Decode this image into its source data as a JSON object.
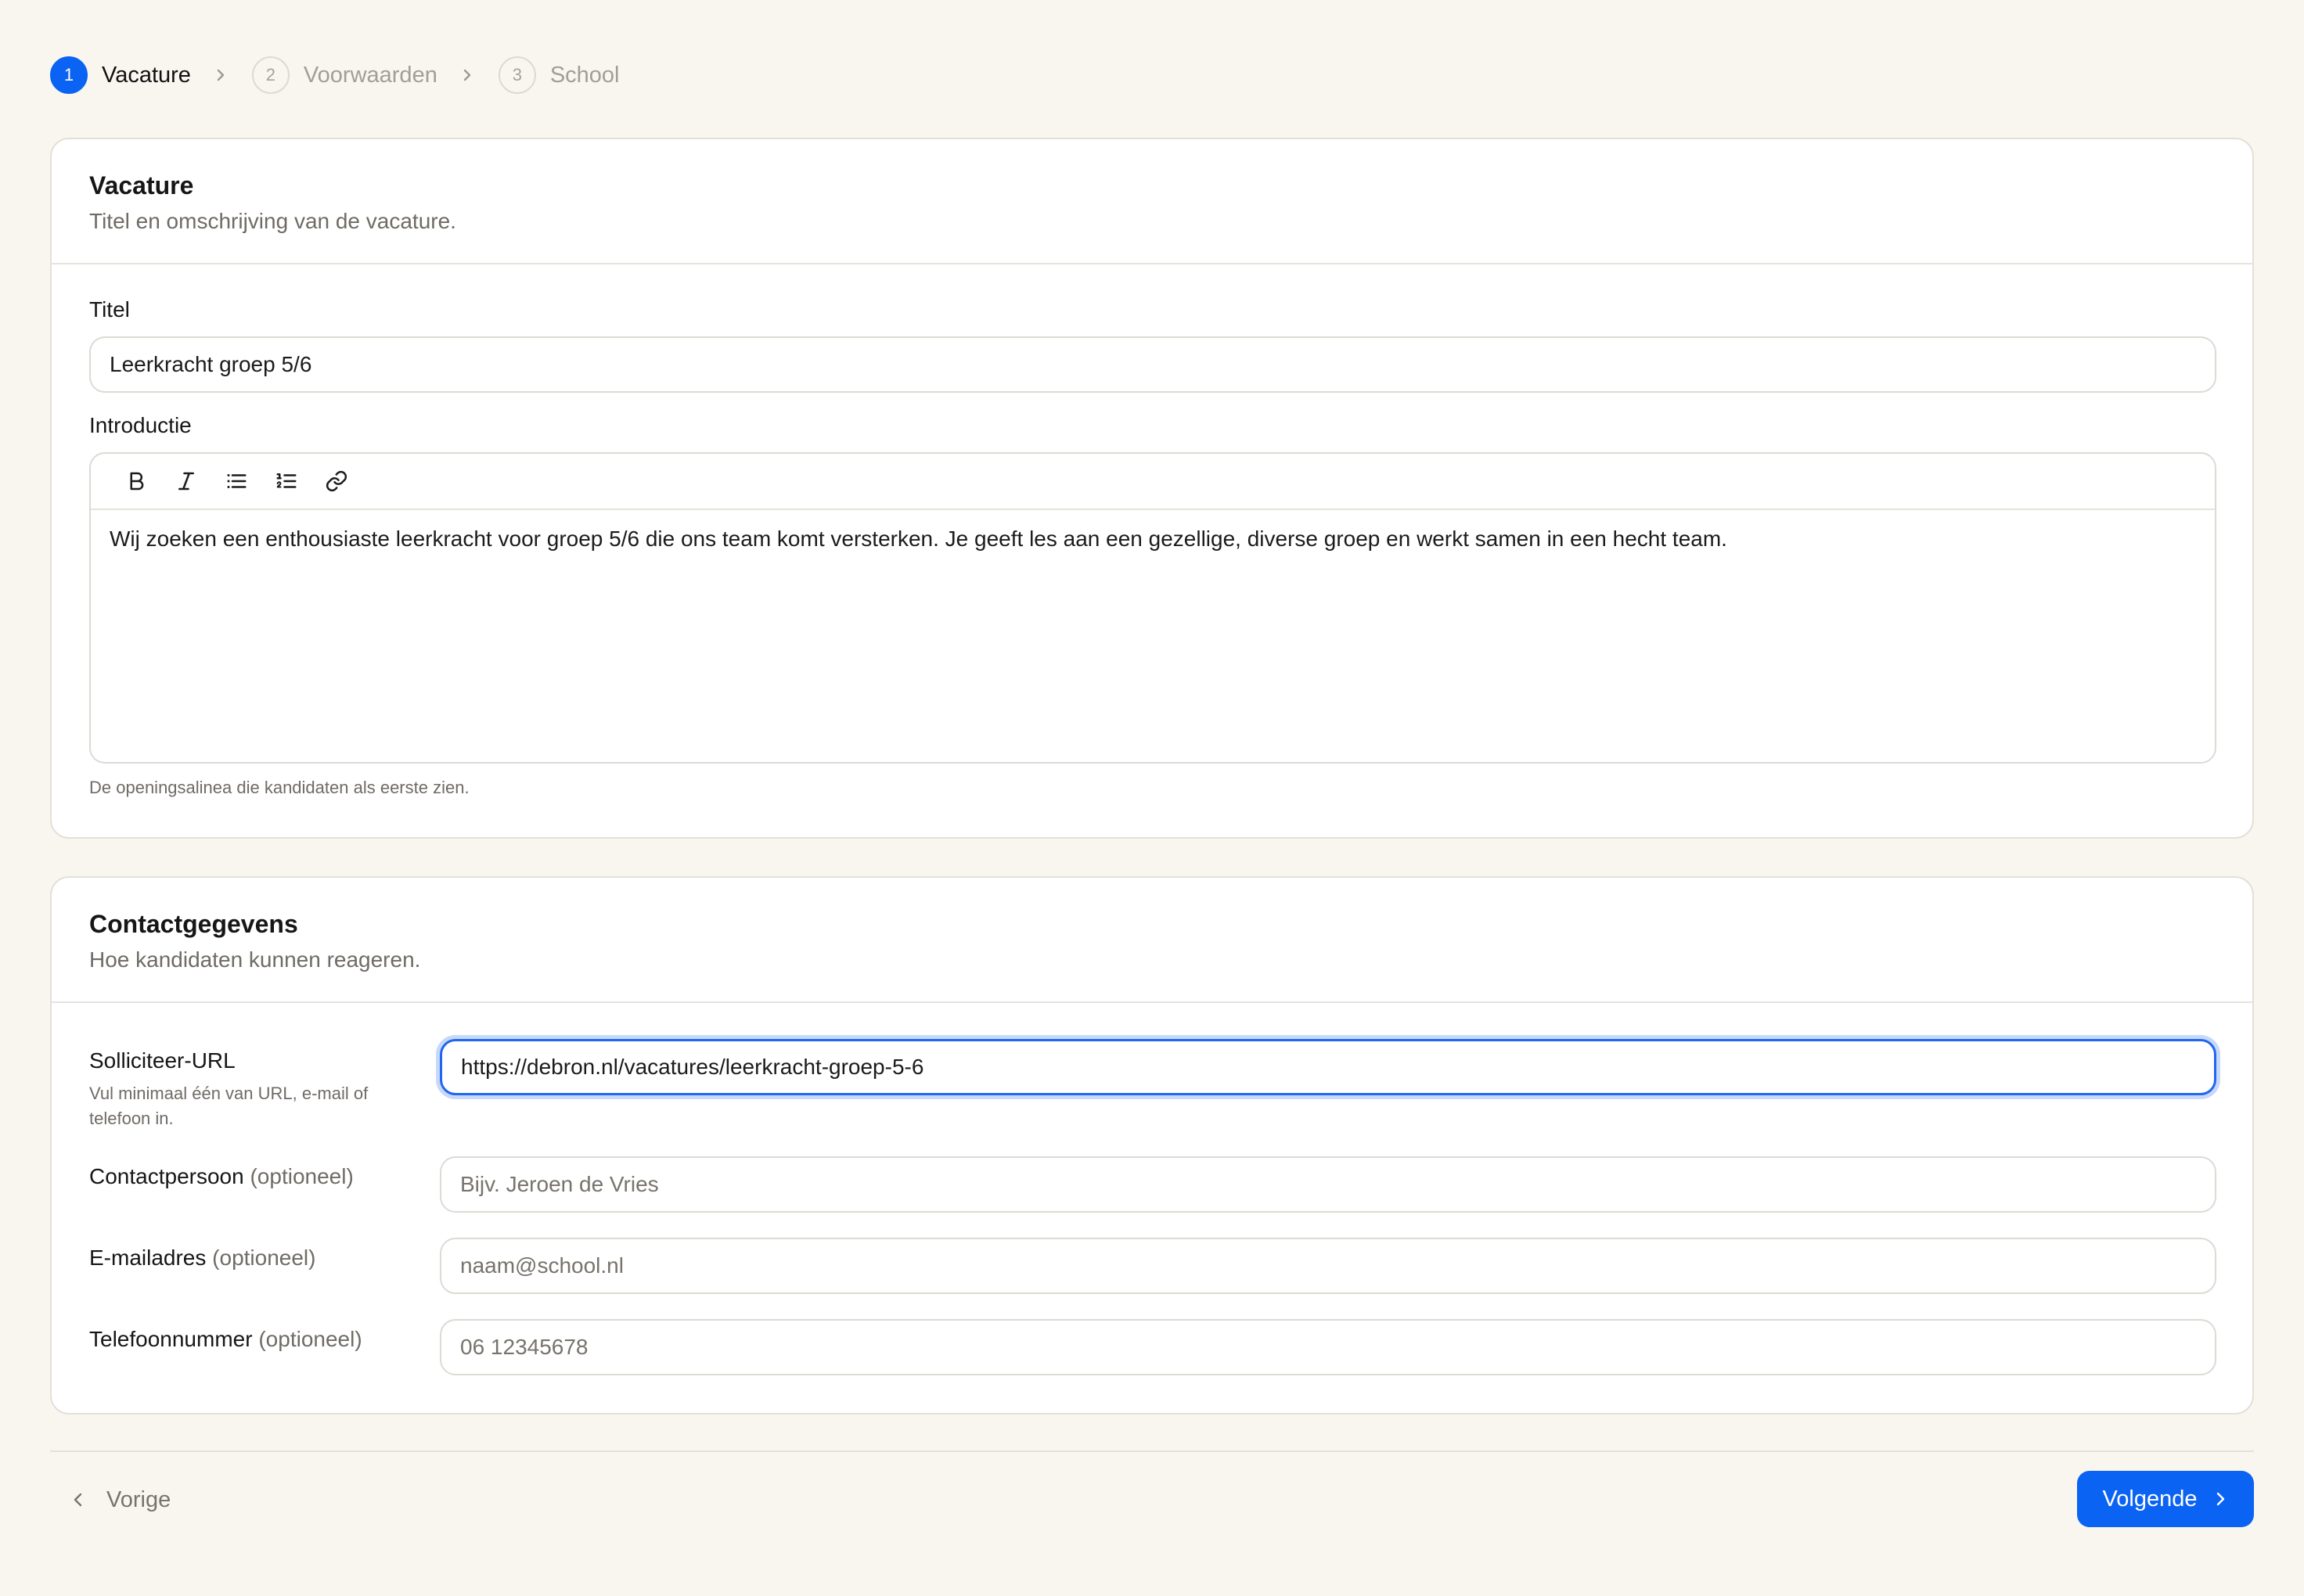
{
  "stepper": {
    "steps": [
      {
        "number": "1",
        "label": "Vacature",
        "active": true
      },
      {
        "number": "2",
        "label": "Voorwaarden",
        "active": false
      },
      {
        "number": "3",
        "label": "School",
        "active": false
      }
    ]
  },
  "vacature": {
    "title": "Vacature",
    "subtitle": "Titel en omschrijving van de vacature.",
    "titel_label": "Titel",
    "titel_value": "Leerkracht groep 5/6",
    "intro_label": "Introductie",
    "toolbar": [
      "bold-icon",
      "italic-icon",
      "bullet-list-icon",
      "numbered-list-icon",
      "link-icon"
    ],
    "intro_text": "Wij zoeken een enthousiaste leerkracht voor groep 5/6 die ons team komt versterken. Je geeft les aan een gezellige, diverse groep en werkt samen in een hecht team.",
    "intro_help": "De openingsalinea die kandidaten als eerste zien."
  },
  "contact": {
    "title": "Contactgegevens",
    "subtitle": "Hoe kandidaten kunnen reageren.",
    "url_label": "Solliciteer-URL",
    "url_help": "Vul minimaal één van URL, e-mail of telefoon in.",
    "url_value": "https://debron.nl/vacatures/leerkracht-groep-5-6",
    "person_label": "Contactpersoon",
    "person_placeholder": "Bijv. Jeroen de Vries",
    "email_label": "E-mailadres",
    "email_placeholder": "naam@school.nl",
    "phone_label": "Telefoonnummer",
    "phone_placeholder": "06 12345678",
    "optional": "(optioneel)"
  },
  "footer": {
    "prev_label": "Vorige",
    "next_label": "Volgende"
  },
  "colors": {
    "accent": "#0b63f3",
    "background": "#f9f6f0"
  }
}
